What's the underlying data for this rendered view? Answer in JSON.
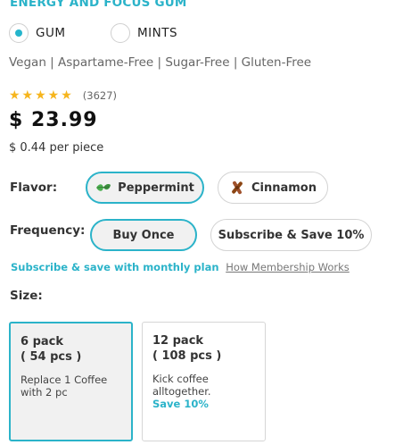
{
  "product": {
    "heading": "ENERGY AND FOCUS GUM",
    "type_options": [
      {
        "label": "GUM",
        "selected": true
      },
      {
        "label": "MINTS",
        "selected": false
      }
    ],
    "tags": "Vegan | Aspartame-Free | Sugar-Free | Gluten-Free",
    "rating": {
      "stars_text": "★★★★★",
      "stars": 5,
      "count": "(3627)"
    },
    "price": "$ 23.99",
    "per_piece": "$ 0.44 per piece"
  },
  "flavor": {
    "label": "Flavor:",
    "options": [
      {
        "label": "Peppermint",
        "icon": "peppermint-leaf-icon",
        "selected": true
      },
      {
        "label": "Cinnamon",
        "icon": "cinnamon-stick-icon",
        "selected": false
      }
    ]
  },
  "frequency": {
    "label": "Frequency:",
    "options": [
      {
        "label": "Buy Once",
        "selected": true
      },
      {
        "label": "Subscribe & Save 10%",
        "selected": false
      }
    ],
    "subscribe_note": "Subscribe & save with monthly plan",
    "membership_link": "How Membership Works"
  },
  "size": {
    "label": "Size:",
    "options": [
      {
        "title_line1": "6 pack",
        "title_line2": "( 54 pcs )",
        "desc": "Replace 1 Coffee with 2 pc",
        "save": "",
        "selected": true
      },
      {
        "title_line1": "12 pack",
        "title_line2": "( 108 pcs )",
        "desc": "Kick coffee alltogether.",
        "save": "Save 10%",
        "selected": false
      }
    ]
  },
  "colors": {
    "accent": "#2bb3c9",
    "star": "#f6b51d"
  }
}
